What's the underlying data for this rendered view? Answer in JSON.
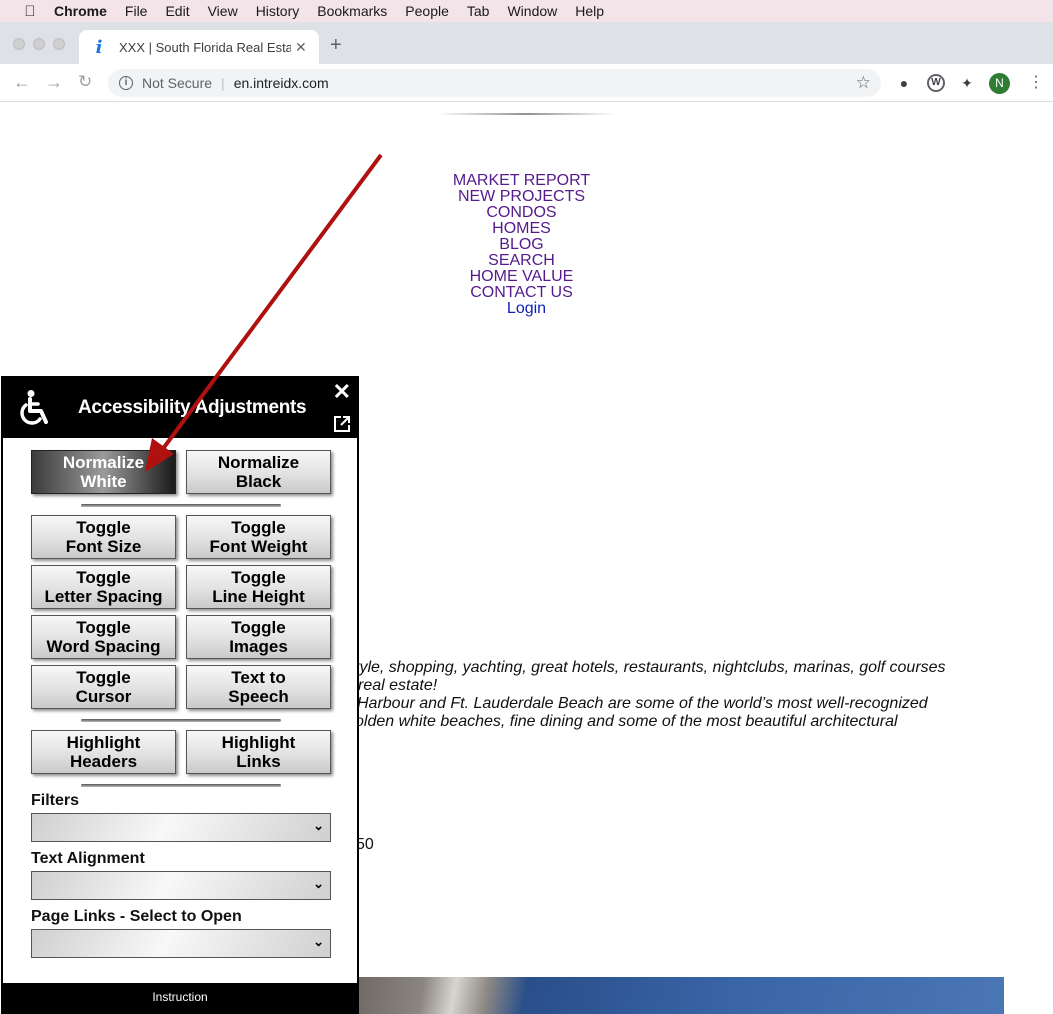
{
  "menubar": {
    "items": [
      "Chrome",
      "File",
      "Edit",
      "View",
      "History",
      "Bookmarks",
      "People",
      "Tab",
      "Window",
      "Help"
    ]
  },
  "browser": {
    "tab_title": "XXX | South Florida Real Estate",
    "not_secure": "Not Secure",
    "url": "en.intreidx.com",
    "avatar_letter": "N"
  },
  "site_nav": {
    "items": [
      "MARKET REPORT",
      "NEW PROJECTS",
      "CONDOS",
      "HOMES",
      "BLOG",
      "SEARCH",
      "HOME VALUE",
      "CONTACT US"
    ],
    "login": "Login"
  },
  "page_text": {
    "line1": "tyle, shopping, yachting, great hotels, restaurants, nightclubs, marinas, golf courses",
    "line2": " real estate!",
    "line3": "Harbour and Ft. Lauderdale Beach are some of the world’s most well-recognized",
    "line4": "olden white beaches, fine dining and some of the most beautiful architectural",
    "fragment": "50"
  },
  "panel": {
    "title": "Accessibility Adjustments",
    "buttons": {
      "normalize_white": [
        "Normalize",
        "White"
      ],
      "normalize_black": [
        "Normalize",
        "Black"
      ],
      "toggle_font_size": [
        "Toggle",
        "Font Size"
      ],
      "toggle_font_weight": [
        "Toggle",
        "Font Weight"
      ],
      "toggle_letter_spacing": [
        "Toggle",
        "Letter Spacing"
      ],
      "toggle_line_height": [
        "Toggle",
        "Line Height"
      ],
      "toggle_word_spacing": [
        "Toggle",
        "Word Spacing"
      ],
      "toggle_images": [
        "Toggle",
        "Images"
      ],
      "toggle_cursor": [
        "Toggle",
        "Cursor"
      ],
      "text_to_speech": [
        "Text to",
        "Speech"
      ],
      "highlight_headers": [
        "Highlight",
        "Headers"
      ],
      "highlight_links": [
        "Highlight",
        "Links"
      ]
    },
    "filters_label": "Filters",
    "text_alignment_label": "Text Alignment",
    "page_links_label": "Page Links - Select to Open",
    "footer": "Instruction"
  },
  "colors": {
    "visited_link": "#551a8b",
    "login_link": "#0b1fb8",
    "annotation_arrow": "#b01010"
  }
}
